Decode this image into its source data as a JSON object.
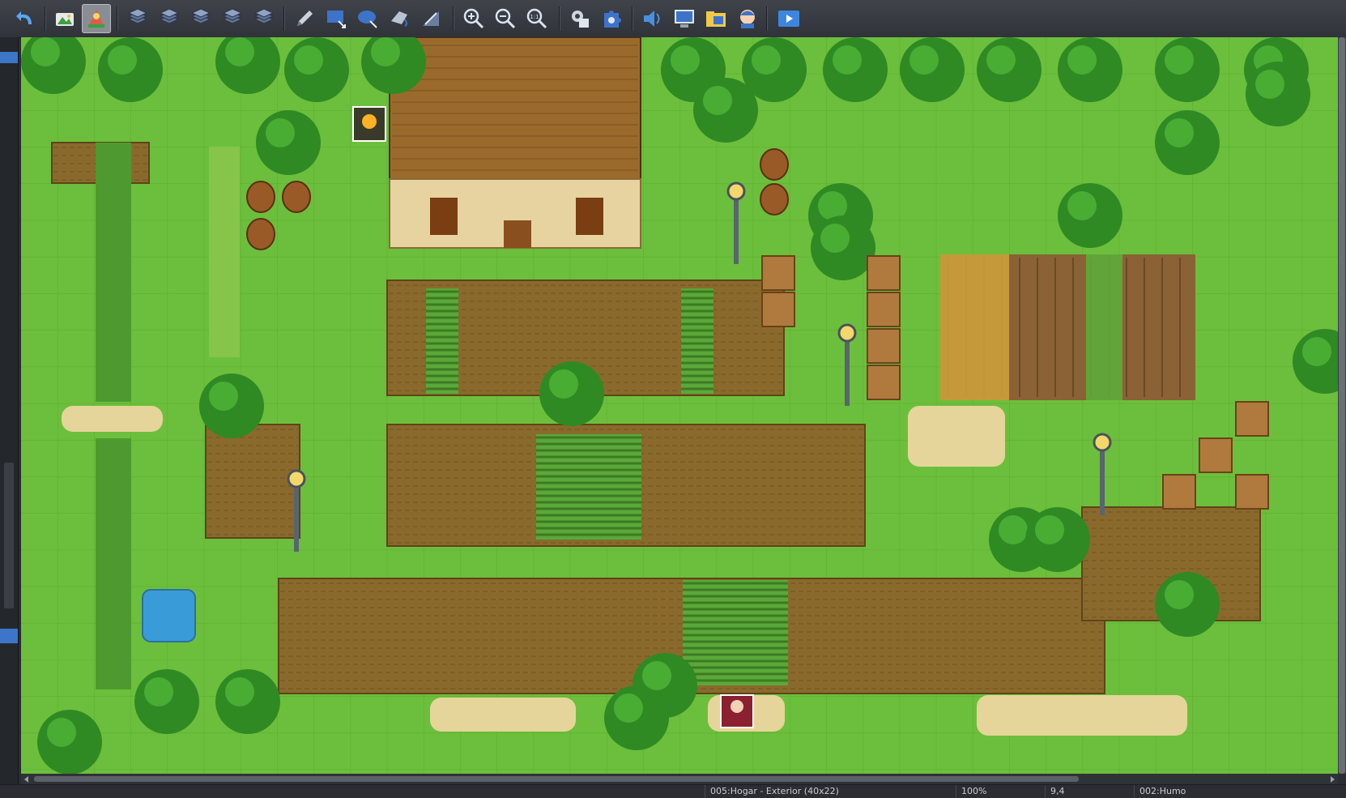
{
  "toolbar": {
    "tools": [
      {
        "id": "undo",
        "icon": "undo-arrow-icon",
        "tip": "Undo"
      },
      {
        "id": "map-mode",
        "icon": "map-mode-icon",
        "tip": "Map"
      },
      {
        "id": "event-mode",
        "icon": "event-mode-icon",
        "tip": "Event",
        "active": true
      },
      {
        "id": "layer-a",
        "icon": "layer-a-icon",
        "tip": "Layer A"
      },
      {
        "id": "layer-b",
        "icon": "layer-b-icon",
        "tip": "Layer B"
      },
      {
        "id": "layer-c",
        "icon": "layer-c-icon",
        "tip": "Layer C"
      },
      {
        "id": "layer-d",
        "icon": "layer-d-icon",
        "tip": "Layer D"
      },
      {
        "id": "layer-r",
        "icon": "region-layer-icon",
        "tip": "Region"
      },
      {
        "id": "pencil",
        "icon": "pencil-icon",
        "tip": "Pencil"
      },
      {
        "id": "rectangle",
        "icon": "rectangle-icon",
        "tip": "Rectangle"
      },
      {
        "id": "ellipse",
        "icon": "ellipse-icon",
        "tip": "Ellipse"
      },
      {
        "id": "fill",
        "icon": "fill-icon",
        "tip": "Flood Fill"
      },
      {
        "id": "shadow-pen",
        "icon": "shadow-pen-icon",
        "tip": "Shadow Pen"
      },
      {
        "id": "zoom-in",
        "icon": "zoom-in-icon",
        "tip": "Zoom In"
      },
      {
        "id": "zoom-out",
        "icon": "zoom-out-icon",
        "tip": "Zoom Out"
      },
      {
        "id": "zoom-actual",
        "icon": "zoom-actual-icon",
        "tip": "Actual Size"
      },
      {
        "id": "database",
        "icon": "database-gear-icon",
        "tip": "Database"
      },
      {
        "id": "plugin-manager",
        "icon": "plugin-puzzle-icon",
        "tip": "Plugin Manager"
      },
      {
        "id": "sound-test",
        "icon": "sound-test-icon",
        "tip": "Sound Test"
      },
      {
        "id": "event-searcher",
        "icon": "event-searcher-icon",
        "tip": "Event Searcher"
      },
      {
        "id": "resource-manager",
        "icon": "resource-manager-icon",
        "tip": "Resource Manager"
      },
      {
        "id": "character-generator",
        "icon": "character-generator-icon",
        "tip": "Character Generator"
      },
      {
        "id": "playtest",
        "icon": "playtest-icon",
        "tip": "Playtest"
      }
    ]
  },
  "status": {
    "map_name": "005:Hogar - Exterior (40x22)",
    "zoom": "100%",
    "coords": "9,4",
    "tile": "002:Humo"
  },
  "colors": {
    "grass": "#6cbf3c",
    "cliff": "#8a6a2c",
    "tree": "#2f8a24",
    "roof": "#9a6a2c",
    "wall": "#e7d3a0",
    "water": "#3a9bd9",
    "accent": "#3d76c9"
  }
}
